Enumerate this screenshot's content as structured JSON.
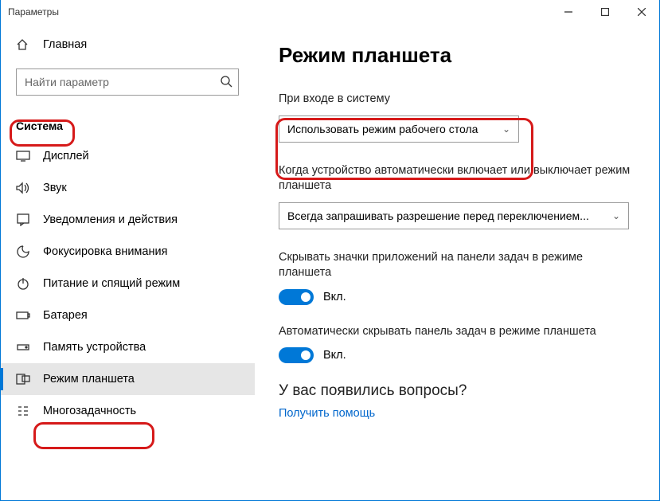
{
  "window": {
    "title": "Параметры"
  },
  "home": {
    "label": "Главная"
  },
  "search": {
    "placeholder": "Найти параметр"
  },
  "section_title": "Система",
  "nav": [
    {
      "label": "Дисплей"
    },
    {
      "label": "Звук"
    },
    {
      "label": "Уведомления и действия"
    },
    {
      "label": "Фокусировка внимания"
    },
    {
      "label": "Питание и спящий режим"
    },
    {
      "label": "Батарея"
    },
    {
      "label": "Память устройства"
    },
    {
      "label": "Режим планшета"
    },
    {
      "label": "Многозадачность"
    }
  ],
  "page": {
    "title": "Режим планшета",
    "signin_label": "При входе в систему",
    "signin_value": "Использовать режим рабочего стола",
    "auto_label": "Когда устройство автоматически включает или выключает режим планшета",
    "auto_value": "Всегда запрашивать разрешение перед переключением...",
    "hide_icons_label": "Скрывать значки приложений на панели задач в режиме планшета",
    "hide_taskbar_label": "Автоматически скрывать панель задач в режиме планшета",
    "toggle_on": "Вкл.",
    "question": "У вас появились вопросы?",
    "help_link": "Получить помощь"
  }
}
